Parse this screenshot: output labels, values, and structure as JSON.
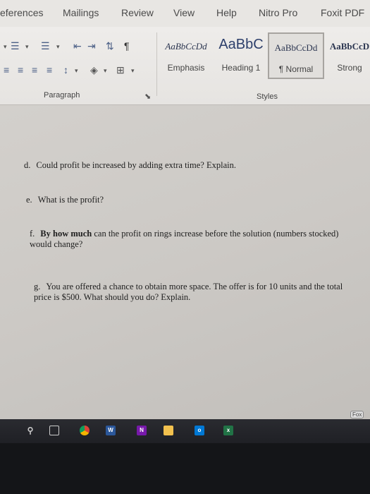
{
  "menu": {
    "tabs": [
      "eferences",
      "Mailings",
      "Review",
      "View",
      "Help",
      "Nitro Pro",
      "Foxit PDF"
    ]
  },
  "ribbon": {
    "paragraph_label": "Paragraph",
    "styles_label": "Styles",
    "styles": [
      {
        "preview": "AaBbCcDd",
        "name": "Emphasis"
      },
      {
        "preview": "AaBbC",
        "name": "Heading 1"
      },
      {
        "preview": "AaBbCcDd",
        "name": "¶ Normal"
      },
      {
        "preview": "AaBbCcD",
        "name": "Strong"
      }
    ]
  },
  "document": {
    "questions": [
      {
        "label": "d.",
        "text": "Could profit be increased by adding extra time? Explain."
      },
      {
        "label": "e.",
        "text": "What is the profit?"
      },
      {
        "label": "f.",
        "bold": "By how much",
        "text": " can the profit on rings increase before the solution (numbers stocked) would change?"
      },
      {
        "label": "g.",
        "text": "You are offered a chance to obtain more space. The offer is for 10 units and the total price is $500. What should you do? Explain."
      }
    ]
  },
  "taskbar": {
    "icons": [
      "pin-icon",
      "task-view-icon",
      "chrome-icon",
      "word-icon",
      "onenote-icon",
      "file-explorer-icon",
      "outlook-icon",
      "excel-icon"
    ],
    "corner_text": "Fox"
  }
}
